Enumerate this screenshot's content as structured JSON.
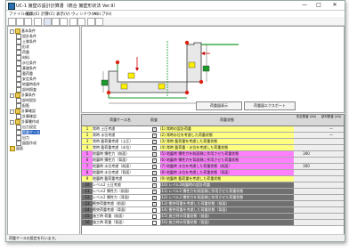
{
  "window": {
    "title": "UC-1 擁壁の設計計算書（統合 擁壁形状法 Ver.9）",
    "controls": [
      "—",
      "□",
      "✕"
    ]
  },
  "menubar": [
    "ファイル(F)",
    "編集(E)",
    "計算(C)",
    "表示(V)",
    "ウィンドウ(W)",
    "ヘルプ(H)"
  ],
  "toolbar": [
    "new-icon",
    "open-icon",
    "save-icon",
    "print-icon",
    "cut-icon",
    "copy-icon",
    "paste-icon",
    "undo-icon",
    "redo-icon",
    "calc-icon",
    "help-icon"
  ],
  "tree": [
    {
      "label": "基本条件",
      "level": 0,
      "kind": "folder",
      "exp": "-"
    },
    {
      "label": "設計条件",
      "level": 1,
      "kind": "item"
    },
    {
      "label": "土質条件",
      "level": 1,
      "kind": "item"
    },
    {
      "label": "形状",
      "level": 1,
      "kind": "item"
    },
    {
      "label": "荷重",
      "level": 1,
      "kind": "item"
    },
    {
      "label": "材料",
      "level": 1,
      "kind": "item"
    },
    {
      "label": "水位条件",
      "level": 1,
      "kind": "item"
    },
    {
      "label": "基礎条件",
      "level": 1,
      "kind": "item"
    },
    {
      "label": "載荷重",
      "level": 1,
      "kind": "item"
    },
    {
      "label": "安定条件",
      "level": 1,
      "kind": "item"
    },
    {
      "label": "地震時条件",
      "level": 1,
      "kind": "item"
    },
    {
      "label": "部材照査",
      "level": 1,
      "kind": "item"
    },
    {
      "label": "計算条件",
      "level": 0,
      "kind": "folder",
      "exp": "-"
    },
    {
      "label": "部材設計",
      "level": 1,
      "kind": "item"
    },
    {
      "label": "配筋",
      "level": 1,
      "kind": "item"
    },
    {
      "label": "計算確認",
      "level": 0,
      "kind": "folder",
      "exp": "-"
    },
    {
      "label": "計算確認",
      "level": 1,
      "kind": "item"
    },
    {
      "label": "計算書作成",
      "level": 0,
      "kind": "folder",
      "exp": "-"
    },
    {
      "label": "出力設定",
      "level": 1,
      "kind": "item"
    },
    {
      "label": "荷重ケース",
      "level": 1,
      "kind": "item",
      "selected": true
    },
    {
      "label": "出力",
      "level": 1,
      "kind": "item"
    },
    {
      "label": "図面作成",
      "level": 1,
      "kind": "item"
    },
    {
      "label": "図面",
      "level": 0,
      "kind": "folder"
    }
  ],
  "canvas_buttons": [
    "荷重図表示",
    "荷重図エクスポート"
  ],
  "table": {
    "headers": [
      "",
      "荷重ケース名",
      "照査",
      "荷重状態",
      "安定照査\n(kN)",
      "部材照査\n(kN)"
    ],
    "rows": [
      {
        "no": "1",
        "name": "常時 土圧考慮",
        "chk": "✓",
        "desc": "(1) 常時の設計荷重",
        "color": "#ffff80",
        "v1": "",
        "v2": "—"
      },
      {
        "no": "2",
        "name": "常時 水位考慮",
        "chk": "✓",
        "desc": "(2) 常時水位を考慮した荷重状態",
        "color": "#ffff80",
        "v1": "",
        "v2": "—"
      },
      {
        "no": "3",
        "name": "常時 載荷重考慮（土圧）",
        "chk": "✓",
        "desc": "(3) 常時 載荷重を考慮した荷重状態",
        "color": "#ffff80",
        "v1": "",
        "v2": ""
      },
      {
        "no": "4",
        "name": "常時 載荷重考慮（水位）",
        "chk": "✓",
        "desc": "(4) 常時 載荷重・水位を考慮した荷重状態",
        "color": "#ffff80",
        "v1": "",
        "v2": ""
      },
      {
        "no": "5",
        "name": "地震時 慣性力（前面）",
        "chk": "✓",
        "desc": "(5) 地震時 慣性力を前面側に作用させた荷重状態",
        "color": "#ff80ff",
        "v1": "300",
        "v2": ""
      },
      {
        "no": "6",
        "name": "地震時 慣性力（背面）",
        "chk": "✓",
        "desc": "(6) 地震時 慣性力を背面側に作用させた荷重状態",
        "color": "#ff80ff",
        "v1": "",
        "v2": ""
      },
      {
        "no": "7",
        "name": "地震時 水位考慮（前面）",
        "chk": "✓",
        "desc": "(7) 地震時 水位を考慮した荷重状態（前面）",
        "color": "#ff80ff",
        "v1": "300",
        "v2": ""
      },
      {
        "no": "8",
        "name": "地震時 水位考慮（背面）",
        "chk": "✓",
        "desc": "(8) 地震時 水位を考慮した荷重状態（背面）",
        "color": "#ff80ff",
        "v1": "",
        "v2": ""
      },
      {
        "no": "9",
        "name": "地震時 載荷重考慮",
        "chk": "✓",
        "desc": "(9) 地震時 載荷重を考慮した荷重状態",
        "color": "#ffff80",
        "v1": "",
        "v2": ""
      },
      {
        "no": "10",
        "name": "レベル2 土圧考慮",
        "chk": "✓",
        "desc": "(10) レベル2地震時の設計荷重",
        "color": "#707070",
        "v1": "",
        "v2": ""
      },
      {
        "no": "11",
        "name": "レベル2 慣性力（前面）",
        "chk": "✓",
        "desc": "(11) レベル2 慣性力を前面側に作用させた荷重状態",
        "color": "#707070",
        "v1": "",
        "v2": ""
      },
      {
        "no": "12",
        "name": "レベル2 慣性力（背面）",
        "chk": "✓",
        "desc": "(12) レベル2 慣性力を背面側に作用させた荷重状態",
        "color": "#707070",
        "v1": "",
        "v2": ""
      },
      {
        "no": "13",
        "name": "衝突荷重考慮（前面）",
        "chk": "✓",
        "desc": "(13) 衝突荷重を考慮した荷重状態（前面）",
        "color": "#707070",
        "v1": "",
        "v2": ""
      },
      {
        "no": "14",
        "name": "衝突荷重考慮（背面）",
        "chk": "",
        "desc": "(14) 衝突荷重を考慮した荷重状態（背面）",
        "color": "#707070",
        "v1": "",
        "v2": ""
      },
      {
        "no": "15",
        "name": "施工時 荷重（前面）",
        "chk": "",
        "desc": "(15) 施工時の荷重状態（前面）",
        "color": "#707070",
        "v1": "",
        "v2": ""
      },
      {
        "no": "16",
        "name": "施工時 荷重（背面）",
        "chk": "",
        "desc": "(16) 施工時の荷重状態（背面）",
        "color": "#707070",
        "v1": "",
        "v2": ""
      }
    ]
  },
  "status": "荷重ケースの設定を行います。"
}
